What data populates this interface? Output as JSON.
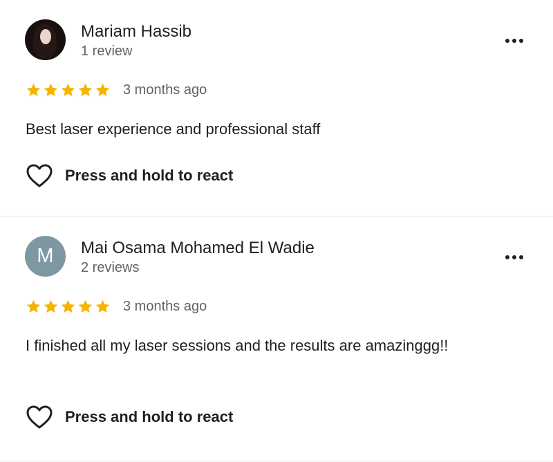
{
  "reviews": [
    {
      "author": "Mariam Hassib",
      "review_count": "1 review",
      "avatar": {
        "type": "photo"
      },
      "stars": 5,
      "time": "3 months ago",
      "text": "Best laser experience and professional staff",
      "react_label": "Press and hold to react"
    },
    {
      "author": "Mai Osama Mohamed El Wadie",
      "review_count": "2 reviews",
      "avatar": {
        "type": "initial",
        "initial": "M"
      },
      "stars": 5,
      "time": "3 months ago",
      "text": "I finished all my laser sessions and the results are amazinggg!!",
      "react_label": "Press and hold to react"
    }
  ],
  "colors": {
    "star": "#f6b400",
    "avatar_initial_bg": "#7e97a3",
    "secondary_text": "#5f6368",
    "divider": "#e3e3e3"
  },
  "icons": {
    "more": "more-horizontal-icon",
    "react": "heart-outline-icon",
    "star": "star-filled-icon"
  }
}
